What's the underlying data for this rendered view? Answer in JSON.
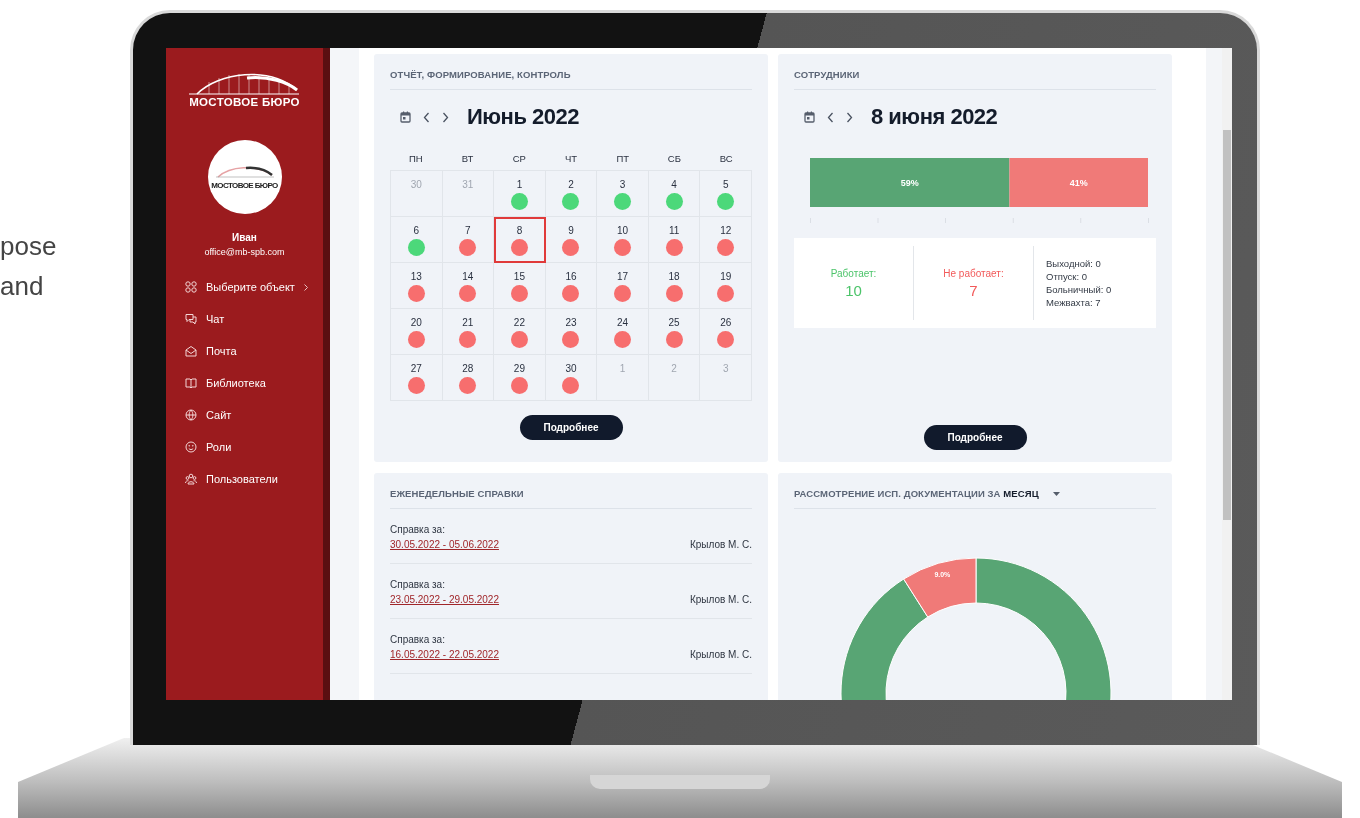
{
  "backdrop_text": [
    "pose",
    "and"
  ],
  "sidebar": {
    "brand": "МОСТОВОЕ БЮРО",
    "avatar_text": "МОСТОВОЕ БЮРО",
    "user_name": "Иван",
    "user_email": "office@mb-spb.com",
    "menu": [
      {
        "label": "Выберите объект",
        "has_submenu": true
      },
      {
        "label": "Чат",
        "has_submenu": false
      },
      {
        "label": "Почта",
        "has_submenu": false
      },
      {
        "label": "Библиотека",
        "has_submenu": false
      },
      {
        "label": "Сайт",
        "has_submenu": false
      },
      {
        "label": "Роли",
        "has_submenu": false
      },
      {
        "label": "Пользователи",
        "has_submenu": false
      }
    ]
  },
  "calendar_card": {
    "title": "ОТЧЁТ, ФОРМИРОВАНИЕ, КОНТРОЛЬ",
    "heading": "Июнь 2022",
    "weekdays": [
      "ПН",
      "ВТ",
      "СР",
      "ЧТ",
      "ПТ",
      "СБ",
      "ВС"
    ],
    "days": [
      {
        "day": "30",
        "current_month": false,
        "selected": false
      },
      {
        "day": "31",
        "current_month": false,
        "selected": false
      },
      {
        "day": "1",
        "current_month": true,
        "selected": false,
        "color": "#4cd87a"
      },
      {
        "day": "2",
        "current_month": true,
        "selected": false,
        "color": "#4cd87a"
      },
      {
        "day": "3",
        "current_month": true,
        "selected": false,
        "color": "#4cd87a"
      },
      {
        "day": "4",
        "current_month": true,
        "selected": false,
        "color": "#4cd87a"
      },
      {
        "day": "5",
        "current_month": true,
        "selected": false,
        "color": "#4cd87a"
      },
      {
        "day": "6",
        "current_month": true,
        "selected": false,
        "color": "#4cd87a"
      },
      {
        "day": "7",
        "current_month": true,
        "selected": false,
        "color": "#f76e6e"
      },
      {
        "day": "8",
        "current_month": true,
        "selected": true,
        "color": "#f76e6e"
      },
      {
        "day": "9",
        "current_month": true,
        "selected": false,
        "color": "#f76e6e"
      },
      {
        "day": "10",
        "current_month": true,
        "selected": false,
        "color": "#f76e6e"
      },
      {
        "day": "11",
        "current_month": true,
        "selected": false,
        "color": "#f76e6e"
      },
      {
        "day": "12",
        "current_month": true,
        "selected": false,
        "color": "#f76e6e"
      },
      {
        "day": "13",
        "current_month": true,
        "selected": false,
        "color": "#f76e6e"
      },
      {
        "day": "14",
        "current_month": true,
        "selected": false,
        "color": "#f76e6e"
      },
      {
        "day": "15",
        "current_month": true,
        "selected": false,
        "color": "#f76e6e"
      },
      {
        "day": "16",
        "current_month": true,
        "selected": false,
        "color": "#f76e6e"
      },
      {
        "day": "17",
        "current_month": true,
        "selected": false,
        "color": "#f76e6e"
      },
      {
        "day": "18",
        "current_month": true,
        "selected": false,
        "color": "#f76e6e"
      },
      {
        "day": "19",
        "current_month": true,
        "selected": false,
        "color": "#f76e6e"
      },
      {
        "day": "20",
        "current_month": true,
        "selected": false,
        "color": "#f76e6e"
      },
      {
        "day": "21",
        "current_month": true,
        "selected": false,
        "color": "#f76e6e"
      },
      {
        "day": "22",
        "current_month": true,
        "selected": false,
        "color": "#f76e6e"
      },
      {
        "day": "23",
        "current_month": true,
        "selected": false,
        "color": "#f76e6e"
      },
      {
        "day": "24",
        "current_month": true,
        "selected": false,
        "color": "#f76e6e"
      },
      {
        "day": "25",
        "current_month": true,
        "selected": false,
        "color": "#f76e6e"
      },
      {
        "day": "26",
        "current_month": true,
        "selected": false,
        "color": "#f76e6e"
      },
      {
        "day": "27",
        "current_month": true,
        "selected": false,
        "color": "#f76e6e"
      },
      {
        "day": "28",
        "current_month": true,
        "selected": false,
        "color": "#f76e6e"
      },
      {
        "day": "29",
        "current_month": true,
        "selected": false,
        "color": "#f76e6e"
      },
      {
        "day": "30",
        "current_month": true,
        "selected": false,
        "color": "#f76e6e"
      },
      {
        "day": "1",
        "current_month": false,
        "selected": false
      },
      {
        "day": "2",
        "current_month": false,
        "selected": false
      },
      {
        "day": "3",
        "current_month": false,
        "selected": false
      }
    ],
    "button": "Подробнее"
  },
  "staff_card": {
    "title": "СОТРУДНИКИ",
    "heading": "8 июня 2022",
    "chart_data": {
      "type": "bar",
      "orientation": "horizontal",
      "stacked": true,
      "series": [
        {
          "color": "#58a574",
          "values": [
            59
          ],
          "value_labels": [
            "59%"
          ]
        },
        {
          "color": "#f07a78",
          "values": [
            41
          ],
          "value_labels": [
            "41%"
          ]
        }
      ]
    },
    "stats": [
      {
        "label": "Работает:",
        "value": "10",
        "color": "#4cc46a"
      },
      {
        "label": "Не работает:",
        "value": "7",
        "color": "#f25a5a"
      }
    ],
    "details": [
      "Выходной: 0",
      "Отпуск: 0",
      "Больничный: 0",
      "Межвахта: 7"
    ],
    "button": "Подробнее"
  },
  "reports_card": {
    "title": "ЕЖЕНЕДЕЛЬНЫЕ СПРАВКИ",
    "items": [
      {
        "label": "Справка за:",
        "period": "30.05.2022 - 05.06.2022",
        "author": "Крылов М. С."
      },
      {
        "label": "Справка за:",
        "period": "23.05.2022 - 29.05.2022",
        "author": "Крылов М. С."
      },
      {
        "label": "Справка за:",
        "period": "16.05.2022 - 22.05.2022",
        "author": "Крылов М. С."
      }
    ]
  },
  "docs_card": {
    "title": "РАССМОТРЕНИЕ ИСП. ДОКУМЕНТАЦИИ ЗА **МЕСЯЦ**",
    "chart_data": {
      "type": "donut",
      "values": [
        91,
        9
      ],
      "colors": [
        "#58a574",
        "#f07a78"
      ],
      "value_labels": [
        null,
        "9.0%"
      ]
    }
  }
}
